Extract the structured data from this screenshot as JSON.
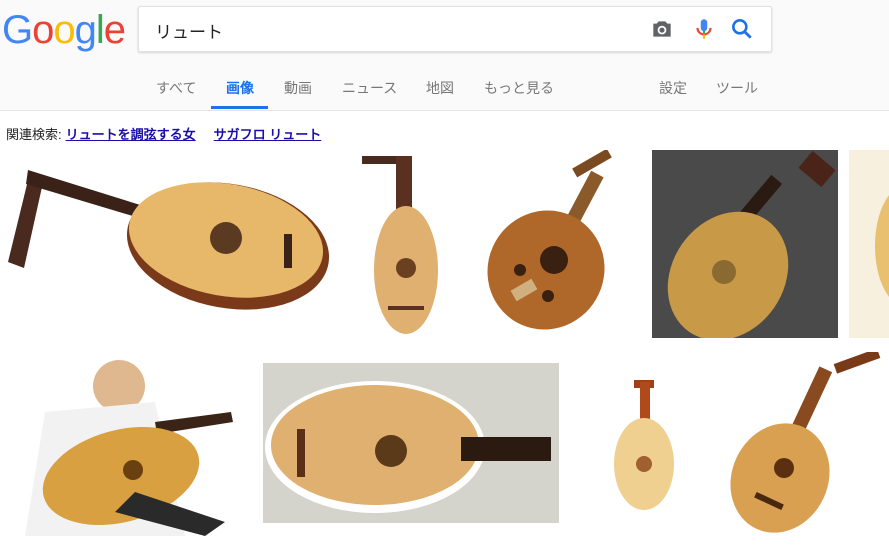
{
  "logo": {
    "letters": [
      "G",
      "o",
      "o",
      "g",
      "l",
      "e"
    ],
    "colors": [
      "#4285f4",
      "#ea4335",
      "#fbbc05",
      "#4285f4",
      "#34a853",
      "#ea4335"
    ]
  },
  "search": {
    "value": "リュート"
  },
  "tabs": [
    {
      "label": "すべて",
      "active": false
    },
    {
      "label": "画像",
      "active": true
    },
    {
      "label": "動画",
      "active": false
    },
    {
      "label": "ニュース",
      "active": false
    },
    {
      "label": "地図",
      "active": false
    },
    {
      "label": "もっと見る",
      "active": false
    },
    {
      "label": "設定",
      "active": false
    },
    {
      "label": "ツール",
      "active": false
    }
  ],
  "related": {
    "prefix": "関連検索:",
    "links": [
      "リュートを調弦する女",
      "サガフロ リュート"
    ]
  },
  "colors": {
    "accent": "#1a73e8",
    "link": "#1a0dab"
  },
  "icons": [
    "camera-icon",
    "microphone-icon",
    "search-icon"
  ]
}
